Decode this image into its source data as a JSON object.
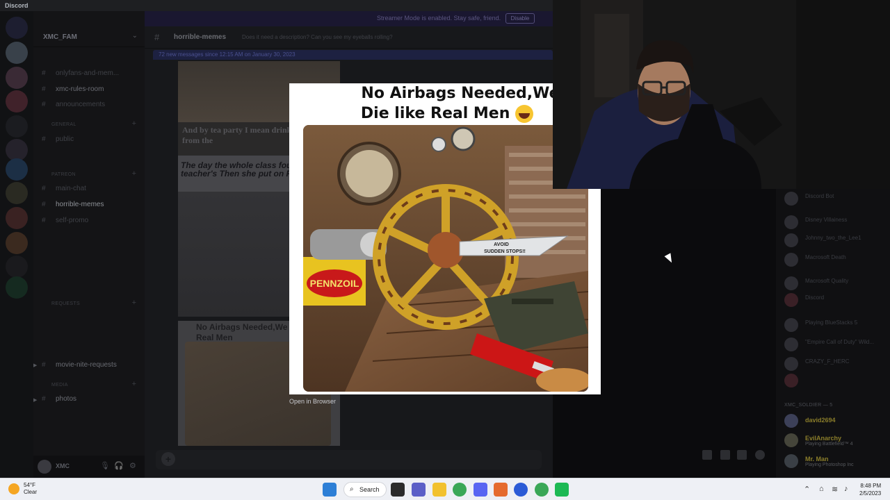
{
  "app": {
    "name": "Discord"
  },
  "server": {
    "name": "XMC_FAM"
  },
  "streamer_banner": {
    "message": "Streamer Mode is enabled. Stay safe, friend.",
    "button": "Disable"
  },
  "channels": [
    {
      "label": "onlyfans-and-mem...",
      "style": "dim"
    },
    {
      "label": "xmc-rules-room",
      "style": "bright"
    },
    {
      "label": "announcements",
      "style": "dim"
    },
    {
      "label": "public",
      "style": "dim"
    },
    {
      "label": "main-chat",
      "style": "dim"
    },
    {
      "label": "horrible-memes",
      "style": "selected"
    },
    {
      "label": "self-promo",
      "style": "dim"
    },
    {
      "label": "movie-nite-requests",
      "style": "bright"
    },
    {
      "label": "photos",
      "style": "bright"
    }
  ],
  "categories": {
    "general": "GENERAL",
    "patreon": "PATREON",
    "requests": "REQUESTS",
    "media": "MEDIA"
  },
  "user_panel": {
    "username": "XMC"
  },
  "chat": {
    "channel": "horrible-memes",
    "topic": "Does it need a description? Can you see my eyeballs rolling?",
    "new_messages": "72 new messages since 12:15 AM on January 30, 2023",
    "meme1_caption": "And by tea party I mean drinking whiskey from the",
    "meme2_caption": "The day the whole class found the teacher's Then she put on Pink",
    "meme3_caption": "No Airbags Needed,We Die like Real Men"
  },
  "modal": {
    "headline_1": "No Airbags Needed,We",
    "headline_2": "Die like Real Men",
    "emoji": "rofl-emoji",
    "photo_text_1": "AVOID",
    "photo_text_2": "SUDDEN STOPS!!",
    "photo_brand": "PENNZOIL",
    "open_in_browser": "Open in Browser"
  },
  "members": {
    "role_header": "XMC_SOLDIER — 5",
    "list": [
      {
        "name": "Discord Bot",
        "status": "",
        "bright": false
      },
      {
        "name": "Disney Villainess",
        "status": "",
        "bright": false
      },
      {
        "name": "Johnny_two_the_Lee1",
        "status": "",
        "bright": false
      },
      {
        "name": "Macrosoft Death",
        "status": "",
        "bright": false
      },
      {
        "name": "Macrosoft Quality",
        "status": "",
        "bright": false
      },
      {
        "name": "Discord",
        "status": "",
        "bright": false
      },
      {
        "name": "Playing BlueStacks 5",
        "status": "",
        "bright": false
      },
      {
        "name": "\"Empire Call of Duty\" Wild...",
        "status": "",
        "bright": false
      },
      {
        "name": "CRAZY_F_HERC",
        "status": "",
        "bright": false
      },
      {
        "name": "david2694",
        "status": "",
        "bright": true
      },
      {
        "name": "EvilAnarchy",
        "status": "Playing Battlefield™ 4",
        "bright": true
      },
      {
        "name": "Mr. Man",
        "status": "Playing Photoshop Inc",
        "bright": true
      }
    ]
  },
  "taskbar": {
    "weather_temp": "54°F",
    "weather_desc": "Clear",
    "search_label": "Search",
    "time": "8:48 PM",
    "date": "2/5/2023"
  },
  "colors": {
    "discord_blurple": "#5865f2",
    "modal_bg": "#ffffff",
    "taskbar_bg": "#eef0f5"
  }
}
